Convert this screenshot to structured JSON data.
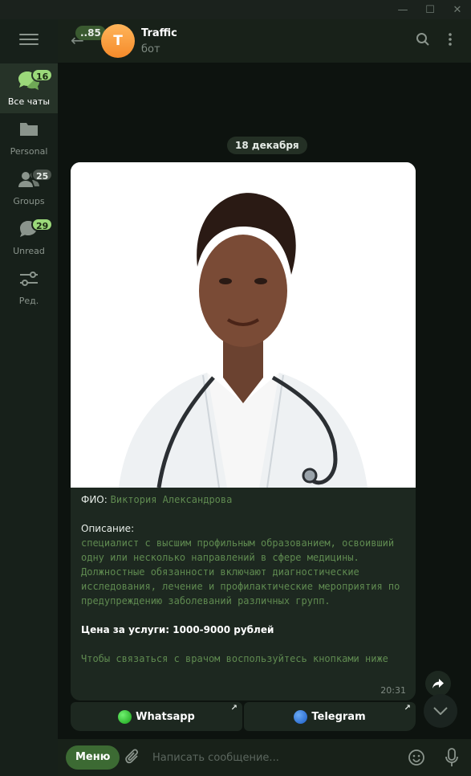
{
  "window": {
    "minimize": "—",
    "maximize": "☐",
    "close": "✕"
  },
  "sidebar": {
    "folders": [
      {
        "label": "Все чаты",
        "badge": "16",
        "icon": "chats-icon"
      },
      {
        "label": "Personal",
        "badge": "",
        "icon": "folder-icon"
      },
      {
        "label": "Groups",
        "badge": "25",
        "icon": "groups-icon"
      },
      {
        "label": "Unread",
        "badge": "29",
        "icon": "unread-icon"
      },
      {
        "label": "Ред.",
        "badge": "",
        "icon": "edit-folders-icon"
      }
    ]
  },
  "header": {
    "unread_count": "..85",
    "avatar_letter": "T",
    "title": "Traffic",
    "subtitle": "бот"
  },
  "chat": {
    "date": "18 декабря",
    "message": {
      "fio_label": "ФИО:",
      "fio_value": "Виктория Александрова",
      "desc_label": "Описание:",
      "desc_value": "специалист с высшим профильным образованием, освоивший одну или несколько направлений в сфере медицины. Должностные обязанности включают диагностические исследования, лечение и профилактические мероприятия по предупреждению заболеваний различных групп.",
      "price": "Цена за услуги: 1000-9000 рублей",
      "contact": "Чтобы связаться с врачом воспользуйтесь кнопками ниже",
      "time": "20:31"
    },
    "keyboard": [
      {
        "label": "Whatsapp",
        "dot_color": "#2bc12b"
      },
      {
        "label": "Telegram",
        "dot_color": "#2a7be4"
      }
    ]
  },
  "composer": {
    "menu_label": "Меню",
    "placeholder": "Написать сообщение..."
  },
  "colors": {
    "accent": "#3c6a33",
    "badge": "#9bd97a",
    "mono_text": "#5f8a50"
  }
}
